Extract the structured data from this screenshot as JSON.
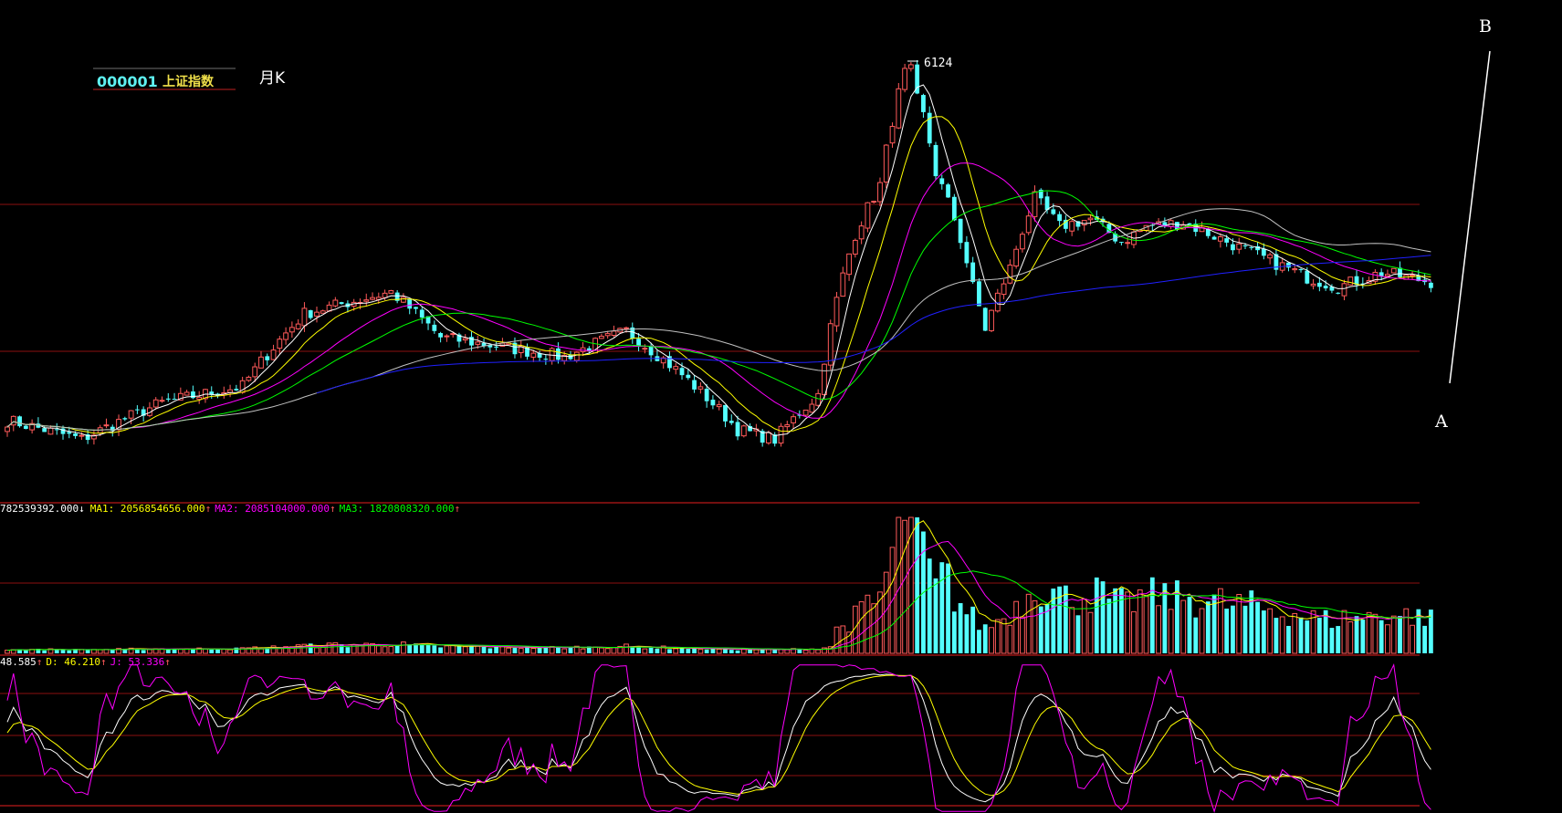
{
  "header": {
    "code": "000001",
    "name": "上证指数",
    "period": "月K"
  },
  "annotations": {
    "peak_label": "6124",
    "point_a": "A",
    "point_b": "B"
  },
  "volume_panel": {
    "vol_value": "782539392.000",
    "vol_arrow": "↓",
    "ma1_label": "MA1: 2056854656.000",
    "ma1_arrow": "↑",
    "ma2_label": "MA2: 2085104000.000",
    "ma2_arrow": "↑",
    "ma3_label": "MA3: 1820808320.000",
    "ma3_arrow": "↑"
  },
  "kdj_panel": {
    "k_label": "48.585",
    "k_arrow": "↑",
    "d_label": "D: 46.210",
    "d_arrow": "↑",
    "j_label": "J: 53.336",
    "j_arrow": "↑"
  },
  "colors": {
    "background": "#000000",
    "up": "#ff5a5a",
    "down": "#54ffff",
    "grid": "#8b1010",
    "ma5": "#ffffff",
    "ma10": "#ffff00",
    "ma20": "#ff00ff",
    "ma30": "#00ff00",
    "ma60": "#c0c0c0",
    "ma120": "#2020ff"
  },
  "chart_data": {
    "type": "candlestick",
    "title": "",
    "period": "monthly",
    "peak_value": 6124,
    "ohlc_anchors": [
      {
        "i": 0,
        "close": 1200
      },
      {
        "i": 12,
        "close": 1100
      },
      {
        "i": 25,
        "close": 1300
      },
      {
        "i": 38,
        "close": 1400
      },
      {
        "i": 48,
        "close": 1950
      },
      {
        "i": 62,
        "close": 2150
      },
      {
        "i": 70,
        "close": 1750
      },
      {
        "i": 90,
        "close": 1600
      },
      {
        "i": 100,
        "close": 1800
      },
      {
        "i": 118,
        "close": 1150
      },
      {
        "i": 124,
        "close": 1100
      },
      {
        "i": 131,
        "close": 1350
      },
      {
        "i": 137,
        "close": 2800
      },
      {
        "i": 141,
        "close": 3500
      },
      {
        "i": 145,
        "close": 5900
      },
      {
        "i": 148,
        "close": 4800
      },
      {
        "i": 150,
        "close": 3700
      },
      {
        "i": 153,
        "close": 3000
      },
      {
        "i": 156,
        "close": 2200
      },
      {
        "i": 158,
        "close": 1820
      },
      {
        "i": 162,
        "close": 2400
      },
      {
        "i": 166,
        "close": 3300
      },
      {
        "i": 170,
        "close": 2900
      },
      {
        "i": 175,
        "close": 3000
      },
      {
        "i": 180,
        "close": 2700
      },
      {
        "i": 184,
        "close": 2900
      },
      {
        "i": 190,
        "close": 2950
      },
      {
        "i": 200,
        "close": 2600
      },
      {
        "i": 210,
        "close": 2300
      },
      {
        "i": 215,
        "close": 2200
      },
      {
        "i": 222,
        "close": 2350
      },
      {
        "i": 230,
        "close": 2250
      }
    ],
    "volume_scale": {
      "max": 3400000000
    },
    "kdj_range": [
      0,
      100
    ],
    "moving_averages": [
      "MA5",
      "MA10",
      "MA20",
      "MA30",
      "MA60",
      "MA120"
    ]
  }
}
